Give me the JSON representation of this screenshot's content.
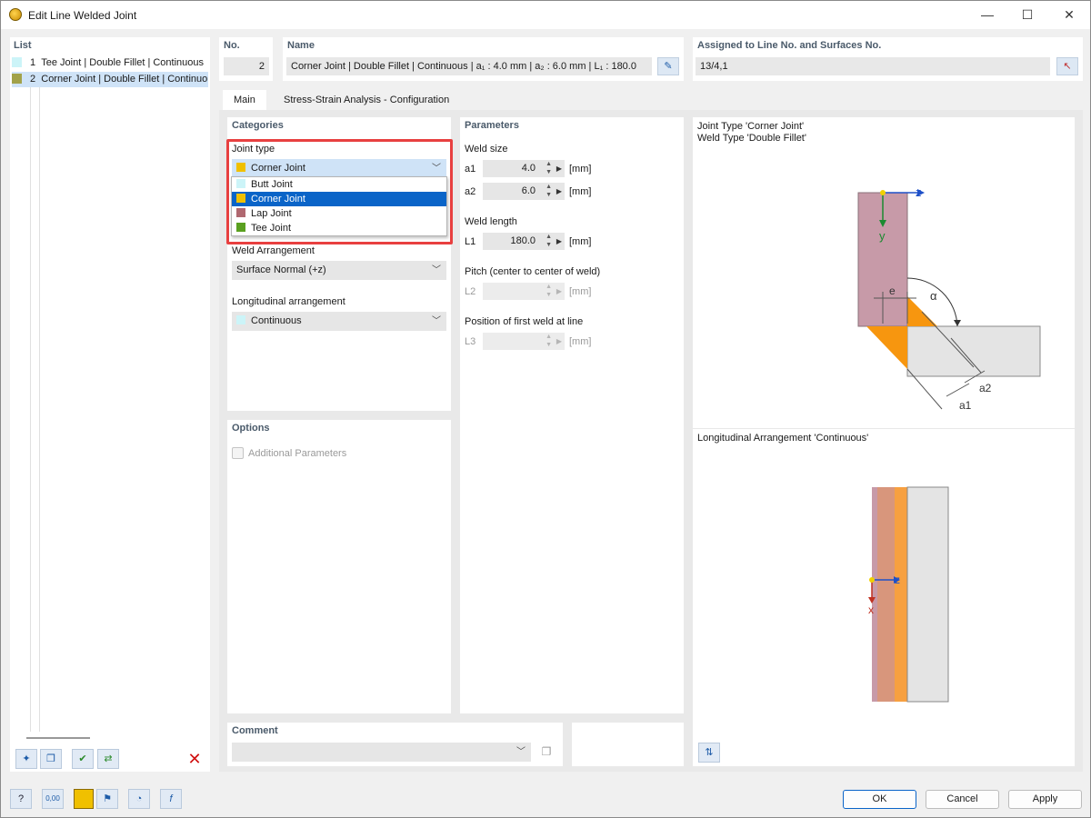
{
  "window": {
    "title": "Edit Line Welded Joint",
    "minimize": "—",
    "maximize": "☐",
    "close": "✕"
  },
  "list": {
    "header": "List",
    "items": [
      {
        "no": "1",
        "label": "Tee Joint | Double Fillet | Continuous",
        "color": "#ccf4f8"
      },
      {
        "no": "2",
        "label": "Corner Joint | Double Fillet | Continuous",
        "color": "#a2a24a"
      }
    ]
  },
  "header": {
    "no_label": "No.",
    "no_value": "2",
    "name_label": "Name",
    "name_value": "Corner Joint | Double Fillet | Continuous | a₁ : 4.0 mm | a₂ : 6.0 mm | L₁ : 180.0",
    "assigned_label": "Assigned to Line No. and Surfaces No.",
    "assigned_value": "13/4,1"
  },
  "tabs": [
    {
      "label": "Main"
    },
    {
      "label": "Stress-Strain Analysis - Configuration"
    }
  ],
  "categories": {
    "header": "Categories",
    "joint_type_label": "Joint type",
    "joint_type_selected": "Corner Joint",
    "joint_type_options": [
      {
        "label": "Butt Joint",
        "color": "#ccf4f8"
      },
      {
        "label": "Corner Joint",
        "color": "#f0c000"
      },
      {
        "label": "Lap Joint",
        "color": "#b06870"
      },
      {
        "label": "Tee Joint",
        "color": "#5aa020"
      }
    ],
    "weld_arrangement_label": "Weld Arrangement",
    "weld_arrangement_value": "Surface Normal (+z)",
    "longitudinal_label": "Longitudinal arrangement",
    "longitudinal_value": "Continuous"
  },
  "options": {
    "header": "Options",
    "additional_parameters": "Additional Parameters"
  },
  "parameters": {
    "header": "Parameters",
    "weld_size_label": "Weld size",
    "a1_label": "a1",
    "a1_value": "4.0",
    "a2_label": "a2",
    "a2_value": "6.0",
    "weld_length_label": "Weld length",
    "l1_label": "L1",
    "l1_value": "180.0",
    "pitch_label": "Pitch (center to center of weld)",
    "l2_label": "L2",
    "position_label": "Position of first weld at line",
    "l3_label": "L3",
    "unit": "[mm]"
  },
  "diagram_top": {
    "title_line1": "Joint Type 'Corner Joint'",
    "title_line2": "Weld Type 'Double Fillet'",
    "axis_z": "z",
    "axis_y": "y",
    "label_e": "e",
    "label_alpha": "α",
    "label_a1": "a1",
    "label_a2": "a2"
  },
  "diagram_bottom": {
    "title": "Longitudinal Arrangement 'Continuous'",
    "axis_z": "z",
    "axis_x": "x"
  },
  "comment": {
    "label": "Comment"
  },
  "footer": {
    "ok": "OK",
    "cancel": "Cancel",
    "apply": "Apply",
    "units_icon_text": "0,00"
  },
  "colors": {
    "accent": "#0a64c8",
    "highlight": "#e84040",
    "plate": "#c79aa8",
    "weld": "#f7960f",
    "plate2": "#e4e4e4"
  }
}
